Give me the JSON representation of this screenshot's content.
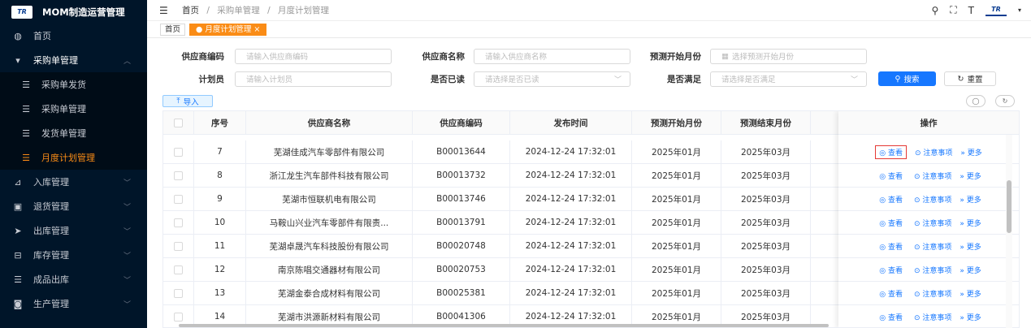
{
  "app": {
    "title": "MOM制造运营管理",
    "logo_text": "TR"
  },
  "sidebar": {
    "items": [
      {
        "label": "首页",
        "icon": "dashboard-icon",
        "glyph": "◍"
      },
      {
        "label": "采购单管理",
        "icon": "cart-icon",
        "glyph": "▾",
        "open": true
      },
      {
        "label": "入库管理",
        "icon": "inbound-icon",
        "glyph": "⊿"
      },
      {
        "label": "退货管理",
        "icon": "return-icon",
        "glyph": "▣"
      },
      {
        "label": "出库管理",
        "icon": "send-icon",
        "glyph": "➤"
      },
      {
        "label": "库存管理",
        "icon": "inventory-icon",
        "glyph": "⊟"
      },
      {
        "label": "成品出库",
        "icon": "list-icon",
        "glyph": "☰"
      },
      {
        "label": "生产管理",
        "icon": "production-icon",
        "glyph": "◙"
      }
    ],
    "sub_items": [
      {
        "label": "采购单发货"
      },
      {
        "label": "采购单管理"
      },
      {
        "label": "发货单管理"
      },
      {
        "label": "月度计划管理",
        "active": true
      }
    ]
  },
  "header": {
    "breadcrumb": [
      "首页",
      "采购单管理",
      "月度计划管理"
    ],
    "icons": [
      "search-icon",
      "fullscreen-icon",
      "font-size-icon",
      "user-logo-icon"
    ]
  },
  "tags": [
    {
      "label": "首页"
    },
    {
      "label": "● 月度计划管理 ×",
      "active": true
    }
  ],
  "filters": {
    "supplier_code": {
      "label": "供应商编码",
      "placeholder": "请输入供应商编码"
    },
    "supplier_name": {
      "label": "供应商名称",
      "placeholder": "请输入供应商名称"
    },
    "forecast_month": {
      "label": "预测开始月份",
      "placeholder": "选择预测开始月份"
    },
    "planner": {
      "label": "计划员",
      "placeholder": "请输入计划员"
    },
    "is_read": {
      "label": "是否已读",
      "placeholder": "请选择是否已读"
    },
    "is_satisfied": {
      "label": "是否满足",
      "placeholder": "请选择是否满足"
    },
    "search_label": "搜索",
    "reset_label": "重置"
  },
  "toolbar": {
    "import_label": "导入"
  },
  "table": {
    "columns": [
      "序号",
      "供应商名称",
      "供应商编码",
      "发布时间",
      "预测开始月份",
      "预测结束月份",
      "操作"
    ],
    "ops": {
      "view": "查看",
      "notes": "注意事项",
      "more": "更多"
    },
    "rows": [
      {
        "no": "7",
        "name": "芜湖佳成汽车零部件有限公司",
        "code": "B00013644",
        "time": "2024-12-24 17:32:01",
        "start": "2025年01月",
        "end": "2025年03月"
      },
      {
        "no": "8",
        "name": "浙江龙生汽车部件科技有限公司",
        "code": "B00013732",
        "time": "2024-12-24 17:32:01",
        "start": "2025年01月",
        "end": "2025年03月"
      },
      {
        "no": "9",
        "name": "芜湖市恒联机电有限公司",
        "code": "B00013746",
        "time": "2024-12-24 17:32:01",
        "start": "2025年01月",
        "end": "2025年03月"
      },
      {
        "no": "10",
        "name": "马鞍山兴业汽车零部件有限责...",
        "code": "B00013791",
        "time": "2024-12-24 17:32:01",
        "start": "2025年01月",
        "end": "2025年03月"
      },
      {
        "no": "11",
        "name": "芜湖卓晟汽车科技股份有限公司",
        "code": "B00020748",
        "time": "2024-12-24 17:32:01",
        "start": "2025年01月",
        "end": "2025年03月"
      },
      {
        "no": "12",
        "name": "南京陈唱交通器材有限公司",
        "code": "B00020753",
        "time": "2024-12-24 17:32:01",
        "start": "2025年01月",
        "end": "2025年03月"
      },
      {
        "no": "13",
        "name": "芜湖金泰合成材料有限公司",
        "code": "B00025381",
        "time": "2024-12-24 17:32:01",
        "start": "2025年01月",
        "end": "2025年03月"
      },
      {
        "no": "14",
        "name": "芜湖市洪源新材料有限公司",
        "code": "B00041306",
        "time": "2024-12-24 17:32:01",
        "start": "2025年01月",
        "end": "2025年03月"
      }
    ]
  },
  "colors": {
    "sidebar_bg": "#001529",
    "accent": "#fa8c16",
    "primary": "#1677ff",
    "highlight": "#e53935"
  }
}
